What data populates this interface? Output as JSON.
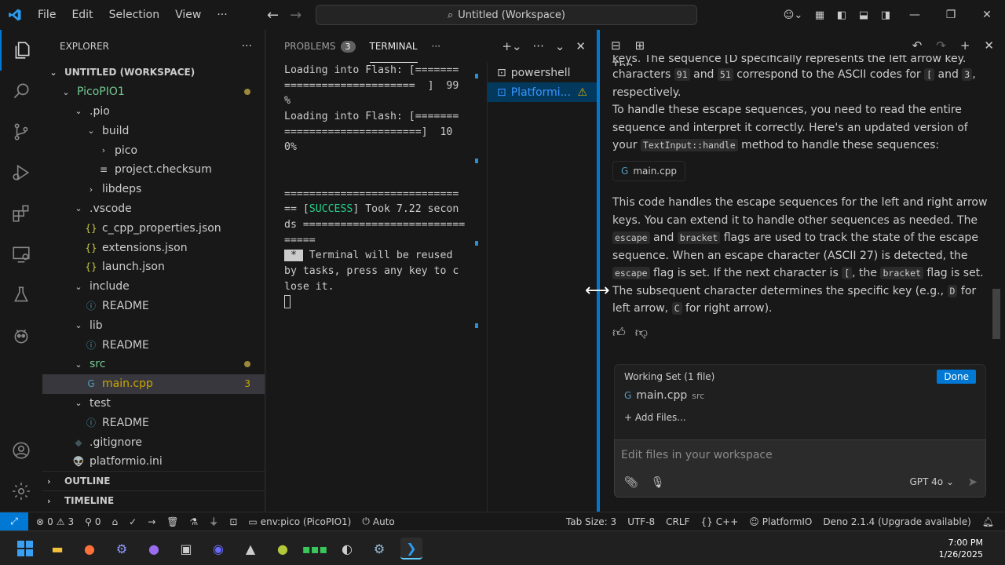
{
  "titlebar": {
    "menu": [
      "File",
      "Edit",
      "Selection",
      "View",
      "···"
    ],
    "search_text": "Untitled (Workspace)"
  },
  "explorer": {
    "title": "EXPLORER",
    "more": "···",
    "workspace": "UNTITLED (WORKSPACE)",
    "rows": [
      {
        "label": "PicoPIO1",
        "depth": 1,
        "twisty": "⌄",
        "color": "#73c991",
        "mark": "dot"
      },
      {
        "label": ".pio",
        "depth": 2,
        "twisty": "⌄"
      },
      {
        "label": "build",
        "depth": 3,
        "twisty": "⌄"
      },
      {
        "label": "pico",
        "depth": 4,
        "twisty": "›"
      },
      {
        "label": "project.checksum",
        "depth": 4,
        "icon": "≡"
      },
      {
        "label": "libdeps",
        "depth": 3,
        "twisty": "›"
      },
      {
        "label": ".vscode",
        "depth": 2,
        "twisty": "⌄"
      },
      {
        "label": "c_cpp_properties.json",
        "depth": 3,
        "icon": "{}"
      },
      {
        "label": "extensions.json",
        "depth": 3,
        "icon": "{}"
      },
      {
        "label": "launch.json",
        "depth": 3,
        "icon": "{}"
      },
      {
        "label": "include",
        "depth": 2,
        "twisty": "⌄"
      },
      {
        "label": "README",
        "depth": 3,
        "icon": "ⓘ"
      },
      {
        "label": "lib",
        "depth": 2,
        "twisty": "⌄"
      },
      {
        "label": "README",
        "depth": 3,
        "icon": "ⓘ"
      },
      {
        "label": "src",
        "depth": 2,
        "twisty": "⌄",
        "color": "#73c991",
        "mark": "dot"
      },
      {
        "label": "main.cpp",
        "depth": 3,
        "icon": "G",
        "color": "#cca700",
        "selected": true,
        "badge": "3"
      },
      {
        "label": "test",
        "depth": 2,
        "twisty": "⌄"
      },
      {
        "label": "README",
        "depth": 3,
        "icon": "ⓘ"
      },
      {
        "label": ".gitignore",
        "depth": 2,
        "icon": "◆"
      },
      {
        "label": "platformio.ini",
        "depth": 2,
        "icon": "👽"
      }
    ],
    "outline": "OUTLINE",
    "timeline": "TIMELINE"
  },
  "panel": {
    "tab_problems": "PROBLEMS",
    "problems_count": "3",
    "tab_terminal": "TERMINAL",
    "terminal_lines": [
      "Loading into Flash: [=======",
      "=====================  ]  99",
      "%",
      "Loading into Flash: [=======",
      "======================]  10",
      "0%",
      "",
      "",
      "============================",
      "== [SUCCESS] Took 7.22 secon",
      "ds ==========================",
      "=====",
      " *  Terminal will be reused",
      "by tasks, press any key to c",
      "lose it."
    ],
    "success_word": "SUCCESS",
    "terminals": [
      "powershell",
      "Platformi..."
    ]
  },
  "chat": {
    "top_line": "keys. The sequence [D specifically represents the left arrow key. The",
    "p1_a": "characters",
    "code_91": "91",
    "and": "and",
    "code_51": "51",
    "p1_b": "correspond to the ASCII codes for",
    "code_lb": "[",
    "code_3": "3",
    "p1_c": ",",
    "p1_d": "respectively.",
    "p2_a": "To handle these escape sequences, you need to read the entire sequence and interpret it correctly. Here's an updated version of your",
    "code_handle": "TextInput::handle",
    "p2_b": "method to handle these sequences:",
    "file_ref": "main.cpp",
    "p3_a": "This code handles the escape sequences for the left and right arrow keys. You can extend it to handle other sequences as needed. The",
    "code_escape": "escape",
    "p3_and": "and",
    "code_bracket": "bracket",
    "p3_b": "flags are used to track the state of the escape sequence. When an escape character (ASCII 27) is detected, the",
    "code_escape2": "escape",
    "p3_c": "flag is set. If the next character is",
    "code_lb2": "[",
    "p3_d": ", the",
    "code_bracket2": "bracket",
    "p3_e": "flag is set. The subsequent character determines the specific key (e.g.,",
    "code_D": "D",
    "p3_f": "for left arrow,",
    "code_C": "C",
    "p3_g": "for right arrow).",
    "working_set": "Working Set (1 file)",
    "done": "Done",
    "ws_file": "main.cpp",
    "ws_dir": "src",
    "add_files": "+ Add Files...",
    "input_placeholder": "Edit files in your workspace",
    "model": "GPT 4o"
  },
  "status": {
    "errors": "0",
    "warnings": "3",
    "ports": "0",
    "env": "env:pico (PicoPIO1)",
    "auto": "Auto",
    "tabsize": "Tab Size: 3",
    "encoding": "UTF-8",
    "eol": "CRLF",
    "lang": "C++",
    "platformio": "PlatformIO",
    "deno": "Deno 2.1.4 (Upgrade available)"
  },
  "taskbar": {
    "time": "7:00 PM",
    "date": "1/26/2025"
  },
  "colors": {
    "accent": "#0078d4",
    "success": "#23d18b",
    "warning": "#cca700",
    "git_untracked": "#73c991"
  }
}
